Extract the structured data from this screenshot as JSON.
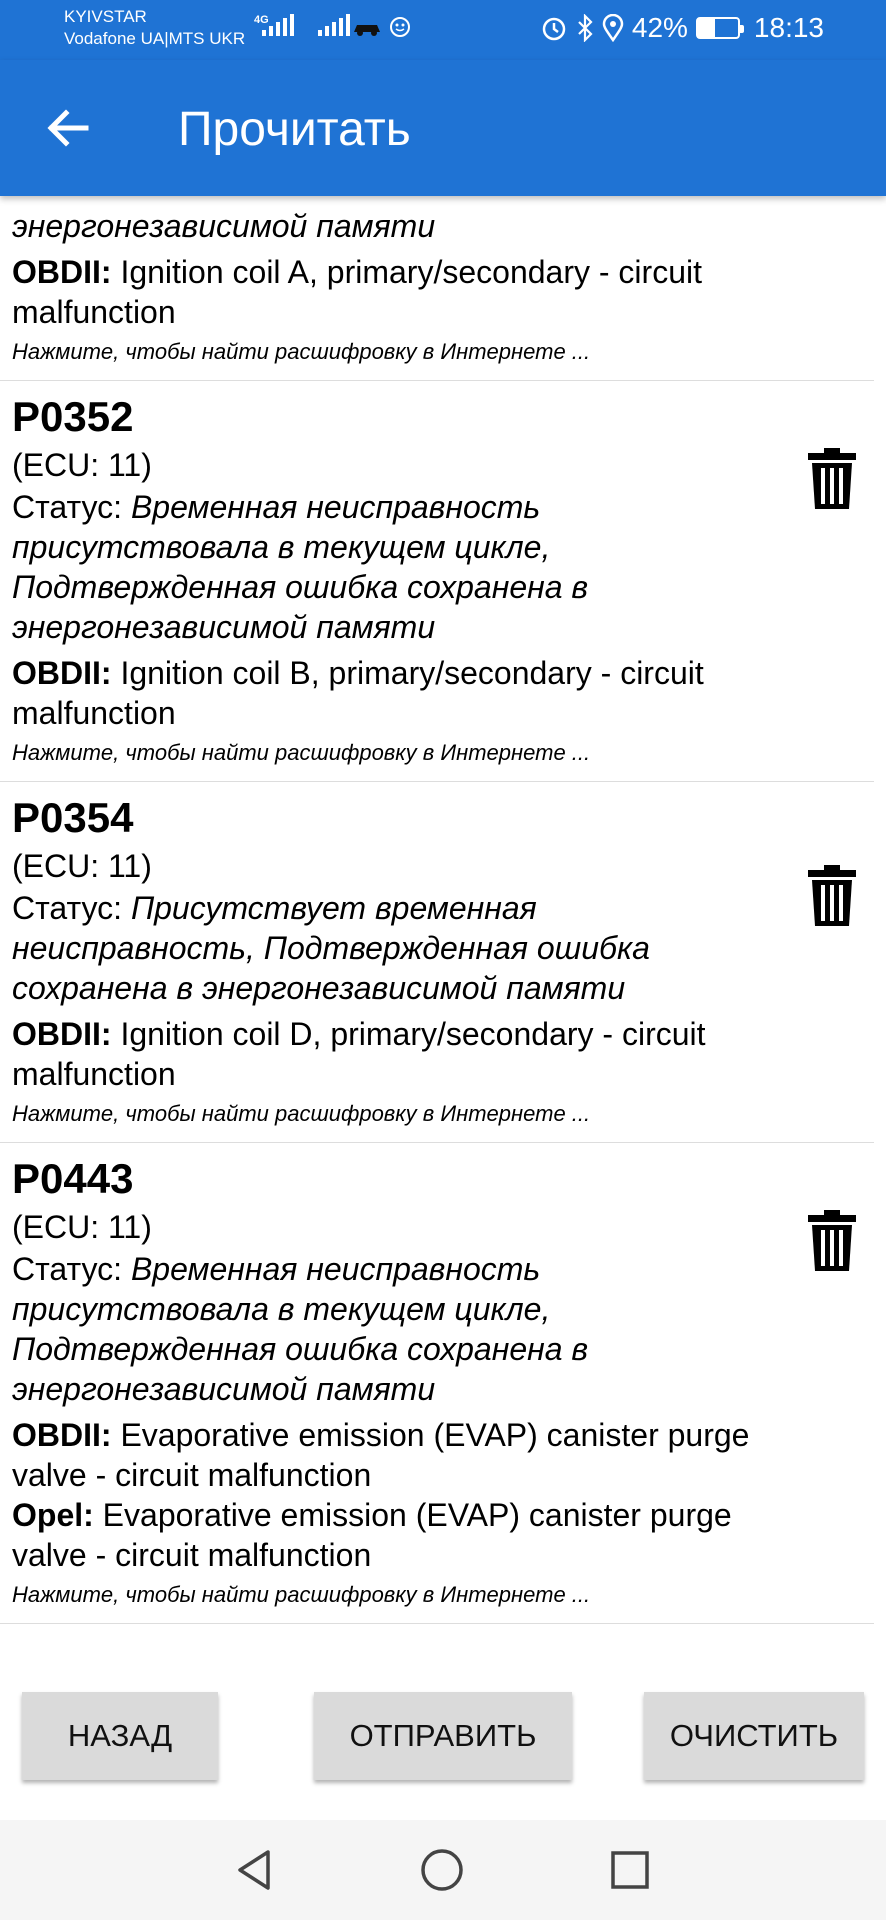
{
  "status_bar": {
    "carrier1": "KYIVSTAR",
    "carrier2": "Vodafone UA|MTS UKR",
    "network": "4G",
    "battery": "42%",
    "battery_level": 0.42,
    "time": "18:13"
  },
  "app_bar": {
    "title": "Прочитать",
    "back_icon": "arrow-left-icon"
  },
  "items": [
    {
      "status_tail": "энергонезависимой памяти",
      "obd_label": "OBDII:",
      "obd_desc": " Ignition coil A, primary/secondary - circuit malfunction",
      "hint": "Нажмите, чтобы найти расшифровку в Интернете ..."
    },
    {
      "code": "P0352",
      "ecu": "(ECU: 11)",
      "status_label": "Статус: ",
      "status_value": "Временная неисправность присутствовала в текущем цикле, Подтвержденная ошибка сохранена в энергонезависимой памяти",
      "obd_label": "OBDII:",
      "obd_desc": " Ignition coil B, primary/secondary - circuit malfunction",
      "hint": "Нажмите, чтобы найти расшифровку в Интернете ..."
    },
    {
      "code": "P0354",
      "ecu": "(ECU: 11)",
      "status_label": "Статус: ",
      "status_value": "Присутствует временная неисправность, Подтвержденная ошибка сохранена в энергонезависимой памяти",
      "obd_label": "OBDII:",
      "obd_desc": " Ignition coil D, primary/secondary - circuit malfunction",
      "hint": "Нажмите, чтобы найти расшифровку в Интернете ..."
    },
    {
      "code": "P0443",
      "ecu": "(ECU: 11)",
      "status_label": "Статус: ",
      "status_value": "Временная неисправность присутствовала в текущем цикле, Подтвержденная ошибка сохранена в энергонезависимой памяти",
      "obd_label": "OBDII:",
      "obd_desc": " Evaporative emission (EVAP) canister purge valve - circuit malfunction",
      "opel_label": "Opel:",
      "opel_desc": " Evaporative emission (EVAP) canister purge valve - circuit malfunction",
      "hint": "Нажмите, чтобы найти расшифровку в Интернете ..."
    }
  ],
  "buttons": {
    "back": "НАЗАД",
    "send": "ОТПРАВИТЬ",
    "clear": "ОЧИСТИТЬ"
  },
  "colors": {
    "primary": "#1f73d4",
    "button": "#dadada"
  },
  "icons": {
    "delete": "trash-icon",
    "nav_back": "nav-back-icon",
    "nav_home": "nav-home-icon",
    "nav_recents": "nav-recents-icon"
  }
}
